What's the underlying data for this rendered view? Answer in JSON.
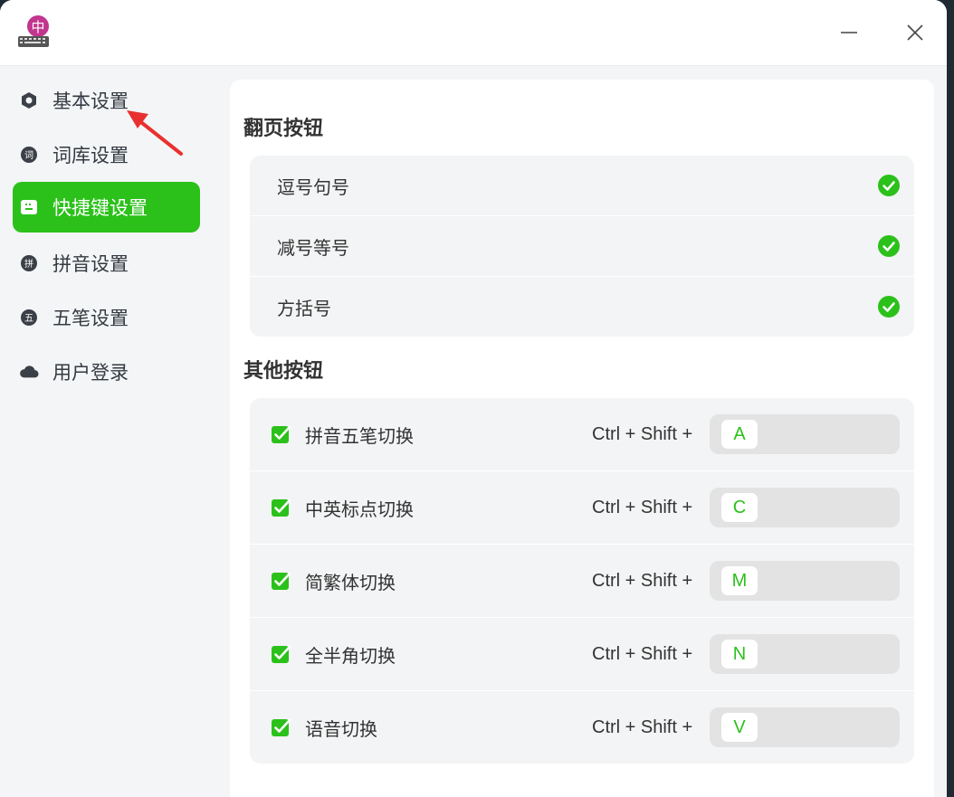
{
  "window": {
    "minimize_symbol": "—",
    "close_symbol": "✕"
  },
  "sidebar": {
    "items": [
      {
        "label": "基本设置",
        "icon": "settings-icon",
        "active": false
      },
      {
        "label": "词库设置",
        "icon": "dictionary-icon",
        "active": false
      },
      {
        "label": "快捷键设置",
        "icon": "keyboard-icon",
        "active": true
      },
      {
        "label": "拼音设置",
        "icon": "pinyin-icon",
        "active": false
      },
      {
        "label": "五笔设置",
        "icon": "wubi-icon",
        "active": false
      },
      {
        "label": "用户登录",
        "icon": "cloud-icon",
        "active": false
      }
    ]
  },
  "page_turn": {
    "title": "翻页按钮",
    "options": [
      {
        "label": "逗号句号",
        "checked": true
      },
      {
        "label": "减号等号",
        "checked": true
      },
      {
        "label": "方括号",
        "checked": true
      }
    ]
  },
  "other": {
    "title": "其他按钮",
    "shortcuts": [
      {
        "label": "拼音五笔切换",
        "checked": true,
        "modifier": "Ctrl + Shift +",
        "key": "A"
      },
      {
        "label": "中英标点切换",
        "checked": true,
        "modifier": "Ctrl + Shift +",
        "key": "C"
      },
      {
        "label": "简繁体切换",
        "checked": true,
        "modifier": "Ctrl + Shift +",
        "key": "M"
      },
      {
        "label": "全半角切换",
        "checked": true,
        "modifier": "Ctrl + Shift +",
        "key": "N"
      },
      {
        "label": "语音切换",
        "checked": true,
        "modifier": "Ctrl + Shift +",
        "key": "V"
      }
    ]
  },
  "colors": {
    "accent": "#2bc11a",
    "annotation_arrow": "#e8312f"
  }
}
